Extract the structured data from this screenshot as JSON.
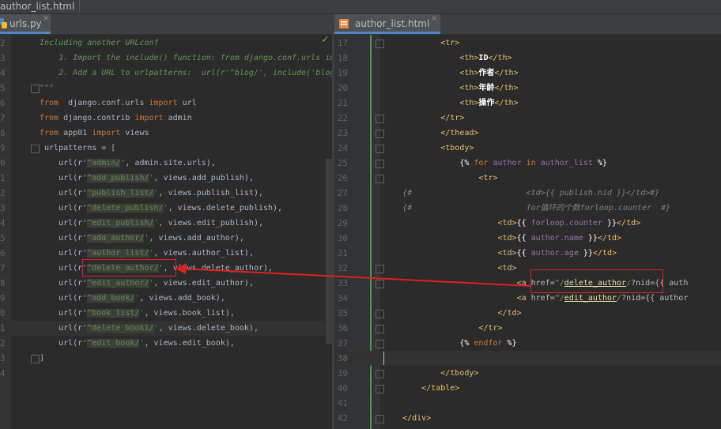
{
  "breadcrumb": "author_list.html",
  "left_tab": {
    "label": "urls.py",
    "close": "×"
  },
  "right_tab": {
    "label": "author_list.html",
    "close": "×"
  },
  "left_lines": [
    {
      "n": "2",
      "segs": [
        [
          "cmt",
          "Including another URLconf"
        ]
      ]
    },
    {
      "n": "3",
      "segs": [
        [
          "cmt",
          "    1. Import the include() function: from django.conf.urls im"
        ]
      ]
    },
    {
      "n": "4",
      "segs": [
        [
          "cmt",
          "    2. Add a URL to urlpatterns:  url(r'^blog/', include('blog"
        ]
      ]
    },
    {
      "n": "5",
      "segs": [
        [
          "cmt",
          "\"\"\""
        ]
      ]
    },
    {
      "n": "6",
      "segs": [
        [
          "kw",
          "from"
        ],
        [
          "",
          "  django.conf.urls "
        ],
        [
          "kw",
          "import"
        ],
        [
          "",
          " url"
        ]
      ]
    },
    {
      "n": "7",
      "segs": [
        [
          "kw",
          "from"
        ],
        [
          "",
          " django.contrib "
        ],
        [
          "kw",
          "import"
        ],
        [
          "",
          " admin"
        ]
      ]
    },
    {
      "n": "8",
      "segs": [
        [
          "kw",
          "from"
        ],
        [
          "",
          " app01 "
        ],
        [
          "kw",
          "import"
        ],
        [
          "",
          " views"
        ]
      ]
    },
    {
      "n": "9",
      "segs": [
        [
          "",
          " urlpatterns = ["
        ]
      ]
    },
    {
      "n": "0",
      "segs": [
        [
          "",
          "    url(r'"
        ],
        [
          "str hl",
          "^admin/"
        ],
        [
          "str",
          "'"
        ],
        [
          "",
          ", admin.site.urls),"
        ]
      ]
    },
    {
      "n": "1",
      "segs": [
        [
          "",
          "    url(r'"
        ],
        [
          "str hl",
          "^add_publish/"
        ],
        [
          "str",
          "'"
        ],
        [
          "",
          ", views.add_publish),"
        ]
      ]
    },
    {
      "n": "2",
      "segs": [
        [
          "",
          "    url(r'"
        ],
        [
          "str hl",
          "^publish_list/"
        ],
        [
          "str",
          "'"
        ],
        [
          "",
          ", views.publish_list),"
        ]
      ]
    },
    {
      "n": "3",
      "segs": [
        [
          "",
          "    url(r'"
        ],
        [
          "str hl",
          "^delete_publish/"
        ],
        [
          "str",
          "'"
        ],
        [
          "",
          ", views.delete_publish),"
        ]
      ]
    },
    {
      "n": "4",
      "segs": [
        [
          "",
          "    url(r'"
        ],
        [
          "str hl",
          "^edit_publish/"
        ],
        [
          "str",
          "'"
        ],
        [
          "",
          ", views.edit_publish),"
        ]
      ]
    },
    {
      "n": "5",
      "segs": [
        [
          "",
          "    url(r'"
        ],
        [
          "str hl",
          "^add_author/"
        ],
        [
          "str",
          "'"
        ],
        [
          "",
          ", views.add_author),"
        ]
      ]
    },
    {
      "n": "6",
      "segs": [
        [
          "",
          "    url(r'"
        ],
        [
          "str hl",
          "^author_list/"
        ],
        [
          "str",
          "'"
        ],
        [
          "",
          ", views.author_list),"
        ]
      ]
    },
    {
      "n": "7",
      "segs": [
        [
          "",
          "    url(r'"
        ],
        [
          "str hl",
          "^delete_author/"
        ],
        [
          "str",
          "'"
        ],
        [
          "",
          ", views.delete_author),"
        ]
      ]
    },
    {
      "n": "8",
      "segs": [
        [
          "",
          "    url(r'"
        ],
        [
          "str hl",
          "^edit_author/"
        ],
        [
          "str",
          "'"
        ],
        [
          "",
          ", views.edit_author),"
        ]
      ]
    },
    {
      "n": "9",
      "segs": [
        [
          "",
          "    url(r'"
        ],
        [
          "str hl",
          "^add_book/"
        ],
        [
          "str",
          "'"
        ],
        [
          "",
          ", views.add_book),"
        ]
      ]
    },
    {
      "n": "0",
      "segs": [
        [
          "",
          "    url(r'"
        ],
        [
          "str hl",
          "^book_list/"
        ],
        [
          "str",
          "'"
        ],
        [
          "",
          ", views.book_list),"
        ]
      ]
    },
    {
      "n": "1",
      "segs": [
        [
          "",
          "    url(r'"
        ],
        [
          "str hl",
          "^delete_book1/"
        ],
        [
          "str",
          "'"
        ],
        [
          "",
          ", views.delete_book),"
        ]
      ]
    },
    {
      "n": "2",
      "segs": [
        [
          "",
          "    url(r'"
        ],
        [
          "str hl",
          "^edit_book/"
        ],
        [
          "str",
          "'"
        ],
        [
          "",
          ", views.edit_book),"
        ]
      ]
    },
    {
      "n": "3",
      "segs": [
        [
          "",
          "]"
        ]
      ]
    },
    {
      "n": "4",
      "segs": []
    }
  ],
  "right_lines": [
    {
      "n": "17",
      "segs": [
        [
          "",
          "            "
        ],
        [
          "tg",
          "<tr>"
        ]
      ]
    },
    {
      "n": "18",
      "segs": [
        [
          "",
          "                "
        ],
        [
          "tg",
          "<th>"
        ],
        [
          "cn",
          "ID"
        ],
        [
          "tg",
          "</th>"
        ]
      ]
    },
    {
      "n": "19",
      "segs": [
        [
          "",
          "                "
        ],
        [
          "tg",
          "<th>"
        ],
        [
          "cn",
          "作者"
        ],
        [
          "tg",
          "</th>"
        ]
      ]
    },
    {
      "n": "20",
      "segs": [
        [
          "",
          "                "
        ],
        [
          "tg",
          "<th>"
        ],
        [
          "cn",
          "年龄"
        ],
        [
          "tg",
          "</th>"
        ]
      ]
    },
    {
      "n": "21",
      "segs": [
        [
          "",
          "                "
        ],
        [
          "tg",
          "<th>"
        ],
        [
          "cn",
          "操作"
        ],
        [
          "tg",
          "</th>"
        ]
      ]
    },
    {
      "n": "22",
      "segs": [
        [
          "",
          "            "
        ],
        [
          "tg",
          "</tr>"
        ]
      ]
    },
    {
      "n": "23",
      "segs": [
        [
          "",
          "            "
        ],
        [
          "tg",
          "</thead>"
        ]
      ]
    },
    {
      "n": "24",
      "segs": [
        [
          "",
          "            "
        ],
        [
          "tg",
          "<tbody>"
        ]
      ]
    },
    {
      "n": "25",
      "segs": [
        [
          "",
          "                "
        ],
        [
          "tpl",
          "{% "
        ],
        [
          "tplk",
          "for"
        ],
        [
          "var",
          " author "
        ],
        [
          "tplk",
          "in"
        ],
        [
          "var",
          " author_list"
        ],
        [
          "tpl",
          " %}"
        ]
      ]
    },
    {
      "n": "26",
      "segs": [
        [
          "",
          "                    "
        ],
        [
          "tg",
          "<tr>"
        ]
      ]
    },
    {
      "n": "27",
      "segs": [
        [
          "cmt2",
          "    {#"
        ],
        [
          "cmt2",
          "                        <td>{{ publish.nid }}</td>#}"
        ]
      ]
    },
    {
      "n": "28",
      "segs": [
        [
          "cmt2",
          "    {#"
        ],
        [
          "cmt2",
          "                        for循环的个数forloop.counter  #}"
        ]
      ]
    },
    {
      "n": "29",
      "segs": [
        [
          "",
          "                        "
        ],
        [
          "tg",
          "<td>"
        ],
        [
          "tpl",
          "{{ "
        ],
        [
          "var",
          "forloop.counter"
        ],
        [
          "tpl",
          " }}"
        ],
        [
          "tg",
          "</td>"
        ]
      ]
    },
    {
      "n": "30",
      "segs": [
        [
          "",
          "                        "
        ],
        [
          "tg",
          "<td>"
        ],
        [
          "tpl",
          "{{ "
        ],
        [
          "var",
          "author.name"
        ],
        [
          "tpl",
          " }}"
        ],
        [
          "tg",
          "</td>"
        ]
      ]
    },
    {
      "n": "31",
      "segs": [
        [
          "",
          "                        "
        ],
        [
          "tg",
          "<td>"
        ],
        [
          "tpl",
          "{{ "
        ],
        [
          "var",
          "author.age"
        ],
        [
          "tpl",
          " }}"
        ],
        [
          "tg",
          "</td>"
        ]
      ]
    },
    {
      "n": "32",
      "segs": [
        [
          "",
          "                        "
        ],
        [
          "tg",
          "<td>"
        ]
      ]
    },
    {
      "n": "33",
      "segs": [
        [
          "",
          "                            "
        ],
        [
          "tg",
          "<a "
        ],
        [
          "attr",
          "href="
        ],
        [
          "aval",
          "\"/"
        ],
        [
          "undl",
          "delete_author"
        ],
        [
          "aval",
          "/"
        ],
        [
          "attr",
          "?nid={{ auth"
        ]
      ]
    },
    {
      "n": "34",
      "segs": [
        [
          "",
          "                            "
        ],
        [
          "tg",
          "<a "
        ],
        [
          "attr",
          "href="
        ],
        [
          "aval",
          "\"/"
        ],
        [
          "undl",
          "edit_author"
        ],
        [
          "aval",
          "/"
        ],
        [
          "attr",
          "?nid={{ author"
        ]
      ]
    },
    {
      "n": "35",
      "segs": [
        [
          "",
          "                        "
        ],
        [
          "tg",
          "</td>"
        ]
      ]
    },
    {
      "n": "36",
      "segs": [
        [
          "",
          "                    "
        ],
        [
          "tg",
          "</tr>"
        ]
      ]
    },
    {
      "n": "37",
      "segs": [
        [
          "",
          "                "
        ],
        [
          "tpl",
          "{% "
        ],
        [
          "tplk",
          "endfor"
        ],
        [
          "tpl",
          " %}"
        ]
      ]
    },
    {
      "n": "38",
      "segs": []
    },
    {
      "n": "39",
      "segs": [
        [
          "",
          "            "
        ],
        [
          "tg",
          "</tbody>"
        ]
      ]
    },
    {
      "n": "40",
      "segs": [
        [
          "",
          "        "
        ],
        [
          "tg",
          "</table>"
        ]
      ]
    },
    {
      "n": "41",
      "segs": []
    },
    {
      "n": "42",
      "segs": [
        [
          "",
          "    "
        ],
        [
          "tg",
          "</div>"
        ]
      ]
    }
  ]
}
